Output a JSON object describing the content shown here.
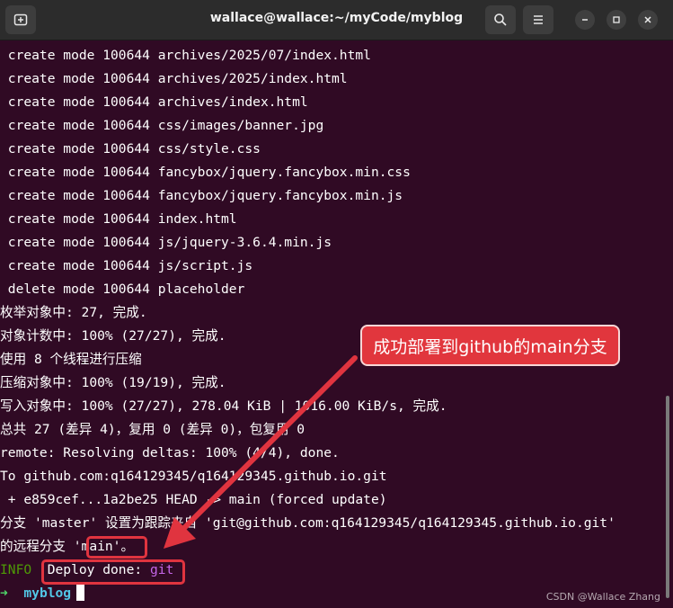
{
  "window": {
    "title": "wallace@wallace:~/myCode/myblog"
  },
  "terminal": {
    "lines": [
      " create mode 100644 archives/2025/07/index.html",
      " create mode 100644 archives/2025/index.html",
      " create mode 100644 archives/index.html",
      " create mode 100644 css/images/banner.jpg",
      " create mode 100644 css/style.css",
      " create mode 100644 fancybox/jquery.fancybox.min.css",
      " create mode 100644 fancybox/jquery.fancybox.min.js",
      " create mode 100644 index.html",
      " create mode 100644 js/jquery-3.6.4.min.js",
      " create mode 100644 js/script.js",
      " delete mode 100644 placeholder",
      "枚举对象中: 27, 完成.",
      "对象计数中: 100% (27/27), 完成.",
      "使用 8 个线程进行压缩",
      "压缩对象中: 100% (19/19), 完成.",
      "写入对象中: 100% (27/27), 278.04 KiB | 1016.00 KiB/s, 完成.",
      "总共 27 (差异 4)，复用 0 (差异 0)，包复用 0",
      "remote: Resolving deltas: 100% (4/4), done.",
      "To github.com:q164129345/q164129345.github.io.git",
      " + e859cef...1a2be25 HEAD -> main (forced update)",
      "分支 'master' 设置为跟踪来自 'git@github.com:q164129345/q164129345.github.io.git'",
      "的远程分支 'main'。"
    ],
    "info_label": "INFO",
    "deploy_text": "Deploy done: ",
    "deploy_target": "git",
    "prompt_arrow": "➜",
    "prompt_dir": "myblog"
  },
  "annotation": {
    "callout_text": "成功部署到github的main分支",
    "box_color": "#e0343f"
  },
  "watermark": "CSDN @Wallace Zhang"
}
